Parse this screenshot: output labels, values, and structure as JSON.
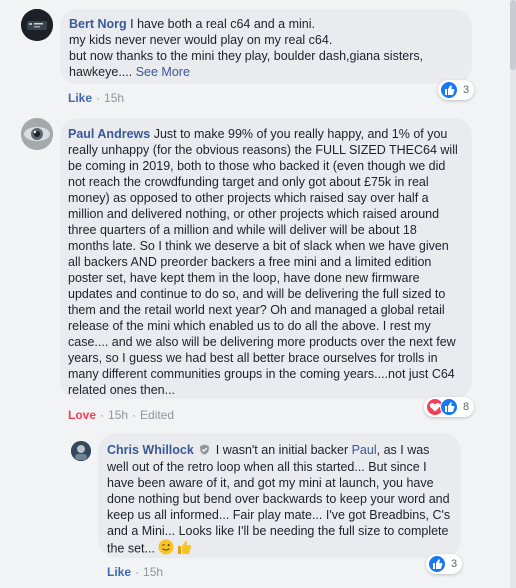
{
  "comments": [
    {
      "author": "Bert Norg",
      "lines": [
        "I have both a real c64 and a mini.",
        "my kids never never would play on my real c64.",
        "but now thanks to the mini they play, boulder dash,giana sisters,",
        "hawkeye.... "
      ],
      "see_more": "See More",
      "action": "Like",
      "time": "15h",
      "reaction_count": "3"
    },
    {
      "author": "Paul Andrews",
      "text": "Just to make 99% of you really happy, and 1% of you really unhappy (for the obvious reasons) the FULL SIZED THEC64 will be coming in 2019, both to those who backed it (even though we did not reach the crowdfunding target and only got about £75k in real money) as opposed to other projects which raised say over half a million and delivered nothing, or other projects which raised around three quarters of a million and while will deliver will be about 18 months late. So I think we deserve a bit of slack when we have given all backers AND preorder backers a free mini and a limited edition poster set, have kept them in the loop, have done new firmware updates and continue to do so, and will be delivering the full sized to them and the retail world next year? Oh and managed a global retail release of the mini which enabled us to do all the above. I rest my case.... and we also will be delivering more products over the next few years, so I guess we had best all better brace ourselves for trolls in many different communities groups in the coming years....not just C64 related ones then...",
      "action": "Love",
      "time": "15h",
      "edited": "Edited",
      "reaction_count": "8"
    },
    {
      "author": "Chris Whillock",
      "text_before": "I wasn't an initial backer ",
      "mention": "Paul",
      "text_after": ", as I was well out of the retro loop when all this started... But since I have been aware of it, and got my mini at launch, you have done nothing but bend over backwards to keep your word and keep us all informed... Fair play mate... I've got Breadbins, C's and a Mini... Looks like I'll be needing the full size to complete the set... ",
      "action": "Like",
      "time": "15h",
      "reaction_count": "3"
    }
  ],
  "icons": {
    "like": "thumbs-up-icon",
    "love": "heart-icon",
    "verified": "verified-badge-icon",
    "emoji_wink": "winking-face-icon",
    "emoji_thumb": "thumbs-up-emoji-icon"
  },
  "colors": {
    "name": "#385898",
    "bubble": "#e9ebee",
    "like": "#1877f2",
    "love": "#f33e58",
    "meta": "#90949c"
  }
}
